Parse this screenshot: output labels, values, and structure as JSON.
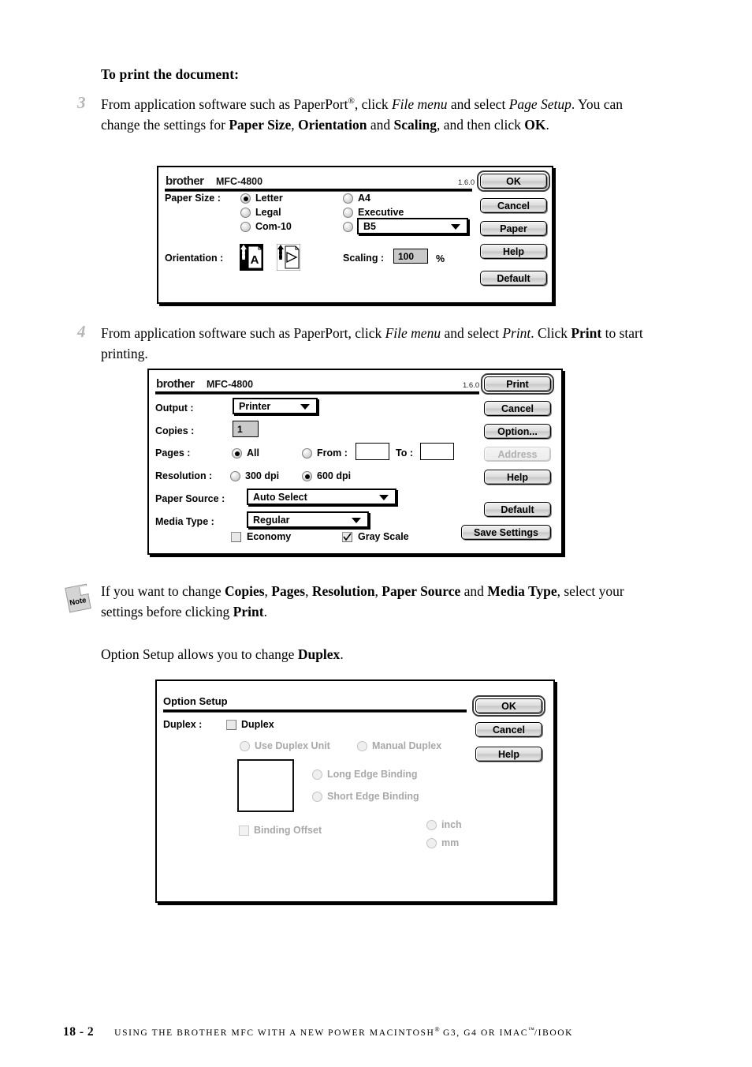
{
  "document": {
    "heading": "To print the document:",
    "step3": {
      "number": "3",
      "seg1": "From application software such as PaperPort",
      "reg": "®",
      "seg2": ", click ",
      "em1": "File menu",
      "seg3": " and select ",
      "em2": "Page Setup",
      "seg4": ". You can change the settings for ",
      "b1": "Paper Size",
      "seg5": ", ",
      "b2": "Orientation",
      "seg6": " and ",
      "b3": "Scaling",
      "seg7": ", and then click ",
      "b4": "OK",
      "seg8": "."
    },
    "step4": {
      "number": "4",
      "seg1": "From application software such as PaperPort, click ",
      "em1": "File menu",
      "seg2": " and select ",
      "em2": "Print",
      "seg3": ". Click ",
      "b1": "Print",
      "seg4": " to start printing."
    },
    "note": {
      "icon_label": "Note",
      "seg1": "If you want to change ",
      "b1": "Copies",
      "seg2": ", ",
      "b2": "Pages",
      "seg3": ", ",
      "b3": "Resolution",
      "seg4": ", ",
      "b4": "Paper Source",
      "seg5": " and ",
      "b5": "Media Type",
      "seg6": ", select your settings before clicking ",
      "b6": "Print",
      "seg7": "."
    },
    "option_line": {
      "seg1": "Option Setup allows you to change ",
      "b1": "Duplex",
      "seg2": "."
    },
    "footer": {
      "page_number": "18 - 2",
      "text_pre": "USING THE BROTHER MFC WITH A NEW POWER MACINTOSH",
      "reg": "®",
      "text_mid": " G3, G4 OR IMAC",
      "tm": "™",
      "text_post": "/IBOOK"
    }
  },
  "page_setup_dialog": {
    "brand": "brother",
    "model": "MFC-4800",
    "version": "1.6.0",
    "paper_size_label": "Paper Size :",
    "paper_size_options": [
      {
        "label": "Letter",
        "selected": true
      },
      {
        "label": "Legal",
        "selected": false
      },
      {
        "label": "Com-10",
        "selected": false
      },
      {
        "label": "A4",
        "selected": false
      },
      {
        "label": "Executive",
        "selected": false
      }
    ],
    "custom_size_selected": false,
    "custom_size_value": "B5",
    "orientation_label": "Orientation :",
    "orientation_selected": "portrait",
    "scaling_label": "Scaling :",
    "scaling_value": "100",
    "scaling_unit": "%",
    "buttons": [
      {
        "label": "OK",
        "default": true,
        "enabled": true
      },
      {
        "label": "Cancel",
        "default": false,
        "enabled": true
      },
      {
        "label": "Paper",
        "default": false,
        "enabled": true
      },
      {
        "label": "Help",
        "default": false,
        "enabled": true
      },
      {
        "label": "Default",
        "default": false,
        "enabled": true
      }
    ]
  },
  "print_dialog": {
    "brand": "brother",
    "model": "MFC-4800",
    "version": "1.6.0",
    "output_label": "Output :",
    "output_value": "Printer",
    "copies_label": "Copies :",
    "copies_value": "1",
    "pages_label": "Pages :",
    "pages_all_label": "All",
    "pages_all_selected": true,
    "pages_from_label": "From :",
    "pages_from_selected": false,
    "pages_from_value": "",
    "pages_to_label": "To :",
    "pages_to_value": "",
    "resolution_label": "Resolution :",
    "resolution_options": [
      {
        "label": "300 dpi",
        "selected": false
      },
      {
        "label": "600 dpi",
        "selected": true
      }
    ],
    "paper_source_label": "Paper Source :",
    "paper_source_value": "Auto Select",
    "media_type_label": "Media Type :",
    "media_type_value": "Regular",
    "economy_label": "Economy",
    "economy_checked": false,
    "gray_scale_label": "Gray Scale",
    "gray_scale_checked": true,
    "buttons": [
      {
        "label": "Print",
        "default": true,
        "enabled": true
      },
      {
        "label": "Cancel",
        "default": false,
        "enabled": true
      },
      {
        "label": "Option...",
        "default": false,
        "enabled": true
      },
      {
        "label": "Address",
        "default": false,
        "enabled": false
      },
      {
        "label": "Help",
        "default": false,
        "enabled": true
      },
      {
        "label": "Default",
        "default": false,
        "enabled": true
      },
      {
        "label": "Save Settings",
        "default": false,
        "enabled": true
      }
    ]
  },
  "option_setup_dialog": {
    "title": "Option Setup",
    "duplex_label": "Duplex :",
    "duplex_checkbox_label": "Duplex",
    "duplex_checked": false,
    "use_duplex_unit_label": "Use Duplex Unit",
    "use_duplex_unit_selected": false,
    "manual_duplex_label": "Manual Duplex",
    "manual_duplex_selected": false,
    "long_edge_label": "Long Edge Binding",
    "long_edge_selected": false,
    "short_edge_label": "Short Edge Binding",
    "short_edge_selected": false,
    "binding_offset_label": "Binding Offset",
    "binding_offset_checked": false,
    "unit_options": [
      {
        "label": "inch",
        "selected": false
      },
      {
        "label": "mm",
        "selected": false
      }
    ],
    "buttons": [
      {
        "label": "OK",
        "default": true,
        "enabled": true
      },
      {
        "label": "Cancel",
        "default": false,
        "enabled": true
      },
      {
        "label": "Help",
        "default": false,
        "enabled": true
      }
    ]
  }
}
